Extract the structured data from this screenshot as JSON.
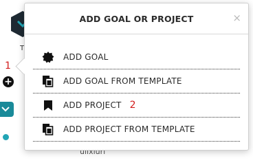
{
  "background": {
    "t_letter": "T",
    "annotation_left": "1",
    "plus_symbol": "+",
    "bottom_text": "ulixiuri"
  },
  "popup": {
    "title": "ADD GOAL OR PROJECT",
    "close_symbol": "×",
    "items": [
      {
        "label": "ADD GOAL",
        "icon": "badge-icon"
      },
      {
        "label": "ADD GOAL FROM TEMPLATE",
        "icon": "template-copy-icon"
      },
      {
        "label": "ADD PROJECT",
        "icon": "bookmark-icon"
      },
      {
        "label": "ADD PROJECT FROM TEMPLATE",
        "icon": "template-copy-icon"
      }
    ],
    "annotation_right": "2"
  },
  "colors": {
    "accent_teal": "#1a8a99",
    "annotation_red": "#d21b1b"
  }
}
